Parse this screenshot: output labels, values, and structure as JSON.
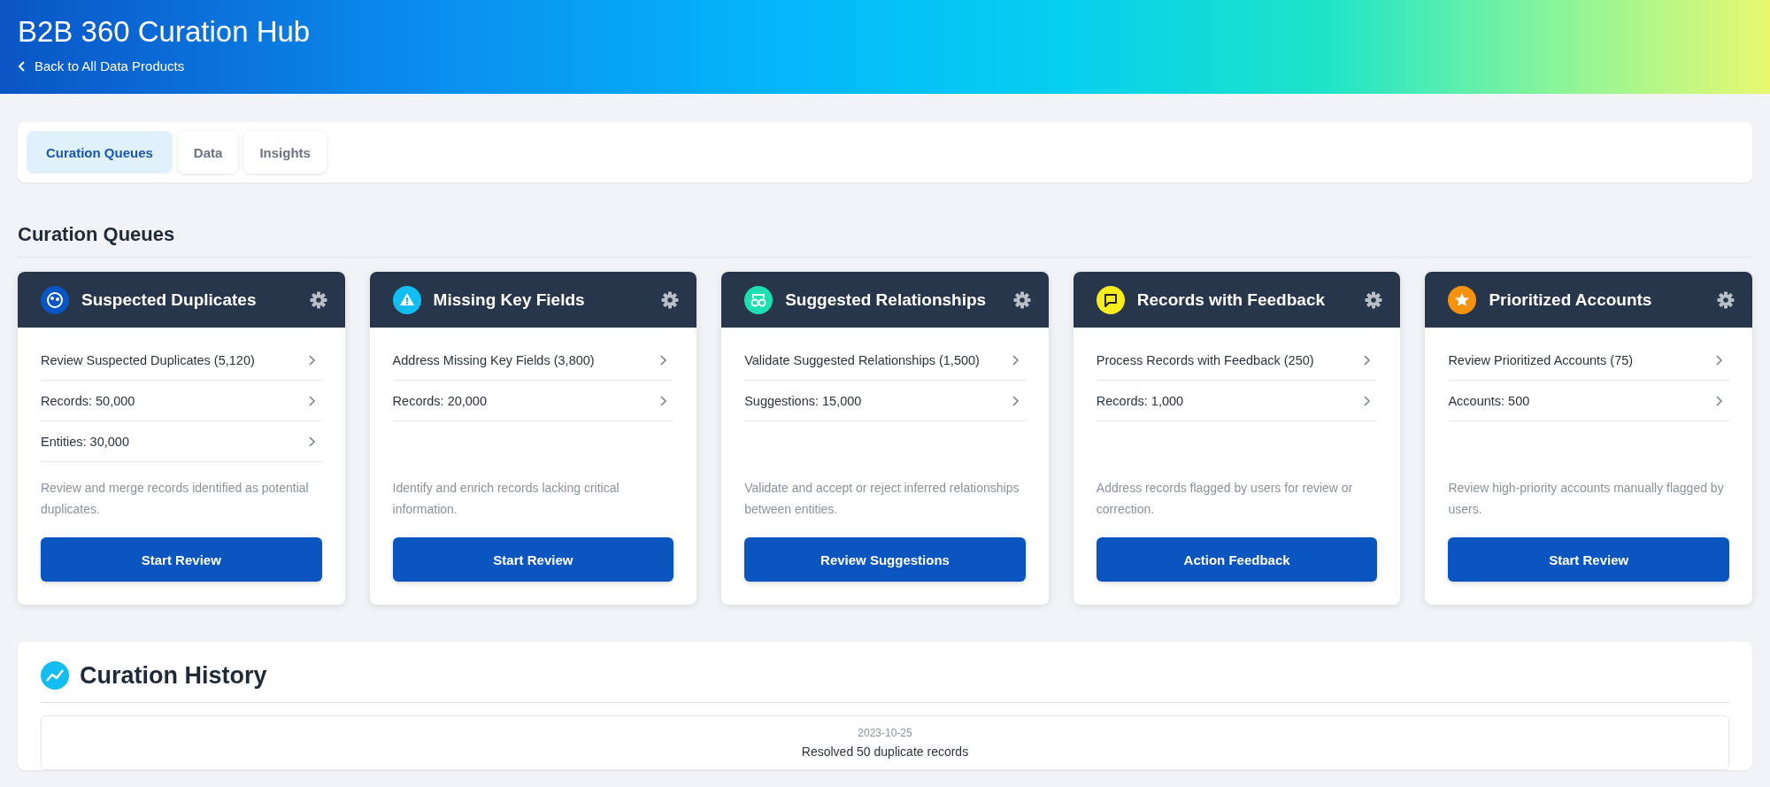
{
  "header": {
    "title": "B2B 360 Curation Hub",
    "back_link": "Back to All Data Products"
  },
  "tabs": [
    {
      "label": "Curation Queues",
      "selected": true
    },
    {
      "label": "Data",
      "selected": false
    },
    {
      "label": "Insights",
      "selected": false
    }
  ],
  "section_title": "Curation Queues",
  "queues": [
    {
      "title": "Suspected Duplicates",
      "color": "#0a55c4",
      "rows": [
        "Review Suspected Duplicates (5,120)",
        "Records: 50,000",
        "Entities: 30,000"
      ],
      "description": "Review and merge records identified as potential duplicates.",
      "button": "Start Review"
    },
    {
      "title": "Missing Key Fields",
      "color": "#12bdf2",
      "rows": [
        "Address Missing Key Fields (3,800)",
        "Records: 20,000"
      ],
      "description": "Identify and enrich records lacking critical information.",
      "button": "Start Review"
    },
    {
      "title": "Suggested Relationships",
      "color": "#1de0b0",
      "rows": [
        "Validate Suggested Relationships (1,500)",
        "Suggestions: 15,000"
      ],
      "description": "Validate and accept or reject inferred relationships between entities.",
      "button": "Review Suggestions"
    },
    {
      "title": "Records with Feedback",
      "color": "#f7ec1c",
      "rows": [
        "Process Records with Feedback (250)",
        "Records: 1,000"
      ],
      "description": "Address records flagged by users for review or correction.",
      "button": "Action Feedback"
    },
    {
      "title": "Prioritized Accounts",
      "color": "#f5920f",
      "rows": [
        "Review Prioritized Accounts (75)",
        "Accounts: 500"
      ],
      "description": "Review high-priority accounts manually flagged by users.",
      "button": "Start Review"
    }
  ],
  "history": {
    "title": "Curation History",
    "entries": [
      {
        "date": "2023-10-25",
        "text": "Resolved 50 duplicate records"
      }
    ]
  }
}
